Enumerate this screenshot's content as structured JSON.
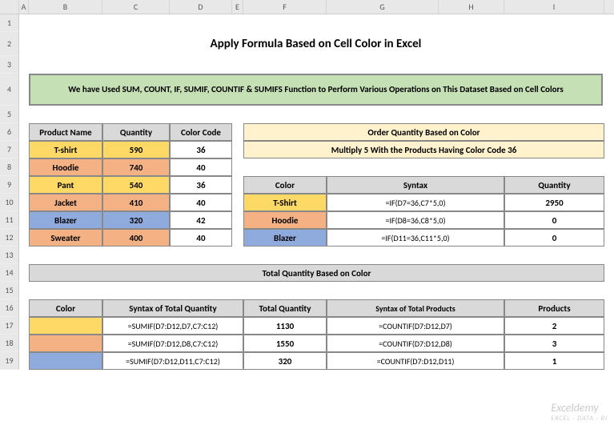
{
  "cols": [
    "A",
    "B",
    "C",
    "D",
    "E",
    "F",
    "G",
    "H",
    "I"
  ],
  "rows": [
    "1",
    "2",
    "3",
    "4",
    "5",
    "6",
    "7",
    "8",
    "9",
    "10",
    "11",
    "12",
    "13",
    "14",
    "15",
    "16",
    "17",
    "18",
    "19"
  ],
  "title": "Apply Formula Based on Cell Color in Excel",
  "greenbox": "We have Used SUM, COUNT, IF, SUMIF, COUNTIF & SUMIFS Function to Perform Various Operations on This Dataset Based on Cell Colors",
  "table1": {
    "headers": [
      "Product Name",
      "Quantity",
      "Color Code"
    ],
    "rows": [
      {
        "name": "T-shirt",
        "qty": "590",
        "code": "36",
        "color": "yellow"
      },
      {
        "name": "Hoodie",
        "qty": "740",
        "code": "40",
        "color": "orange"
      },
      {
        "name": "Pant",
        "qty": "540",
        "code": "36",
        "color": "yellow"
      },
      {
        "name": "Jacket",
        "qty": "410",
        "code": "40",
        "color": "orange"
      },
      {
        "name": "Blazer",
        "qty": "320",
        "code": "42",
        "color": "blue"
      },
      {
        "name": "Sweater",
        "qty": "400",
        "code": "40",
        "color": "orange"
      }
    ]
  },
  "orderbox": {
    "line1": "Order Quantity Based on Color",
    "line2": "Multiply 5 With the Products Having Color Code 36"
  },
  "table2": {
    "headers": [
      "Color",
      "Syntax",
      "Quantity"
    ],
    "rows": [
      {
        "color": "T-Shirt",
        "syntax": "=IF(D7=36,C7*5,0)",
        "qty": "2950",
        "cls": "yellow"
      },
      {
        "color": "Hoodie",
        "syntax": "=IF(D8=36,C8*5,0)",
        "qty": "0",
        "cls": "orange"
      },
      {
        "color": "Blazer",
        "syntax": "=IF(D11=36,C11*5,0)",
        "qty": "0",
        "cls": "blue"
      }
    ]
  },
  "section3_title": "Total Quantity Based on Color",
  "table3": {
    "headers": [
      "Color",
      "Syntax of Total Quantity",
      "Total Quantity",
      "Syntax of Total Products",
      "Products"
    ],
    "rows": [
      {
        "cls": "yellow",
        "stq": "=SUMIF(D7:D12,D7,C7:C12)",
        "tq": "1130",
        "stp": "=COUNTIF(D7:D12,D7)",
        "p": "2"
      },
      {
        "cls": "orange",
        "stq": "=SUMIF(D7:D12,D8,C7:C12)",
        "tq": "1550",
        "stp": "=COUNTIF(D7:D12,D8)",
        "p": "3"
      },
      {
        "cls": "blue",
        "stq": "=SUMIF(D7:D12,D11,C7:C12)",
        "tq": "320",
        "stp": "=COUNTIF(D7:D12,D11)",
        "p": "1"
      }
    ]
  },
  "watermark": {
    "main": "Exceldemy",
    "sub": "EXCEL · DATA · BI"
  }
}
